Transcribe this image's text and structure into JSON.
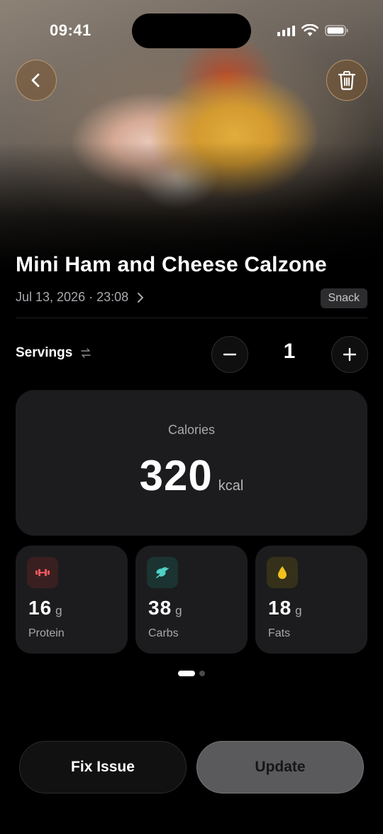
{
  "status_bar": {
    "time": "09:41"
  },
  "food": {
    "name": "Mini Ham and Cheese Calzone",
    "datetime": "Jul 13, 2026 · 23:08",
    "meal_tag": "Snack"
  },
  "servings": {
    "label": "Servings",
    "value": "1"
  },
  "calories": {
    "label": "Calories",
    "value": "320",
    "unit": "kcal"
  },
  "macros": [
    {
      "value": "16",
      "unit": "g",
      "name": "Protein",
      "icon": "dumbbell-icon",
      "color": "#f0575a",
      "bg": "#3a1f21"
    },
    {
      "value": "38",
      "unit": "g",
      "name": "Carbs",
      "icon": "wheat-icon",
      "color": "#4fd1c5",
      "bg": "#1b3331"
    },
    {
      "value": "18",
      "unit": "g",
      "name": "Fats",
      "icon": "drop-icon",
      "color": "#f2c21b",
      "bg": "#34301a"
    }
  ],
  "pager": {
    "pages": 2,
    "active": 1
  },
  "actions": {
    "fix_label": "Fix Issue",
    "update_label": "Update"
  }
}
